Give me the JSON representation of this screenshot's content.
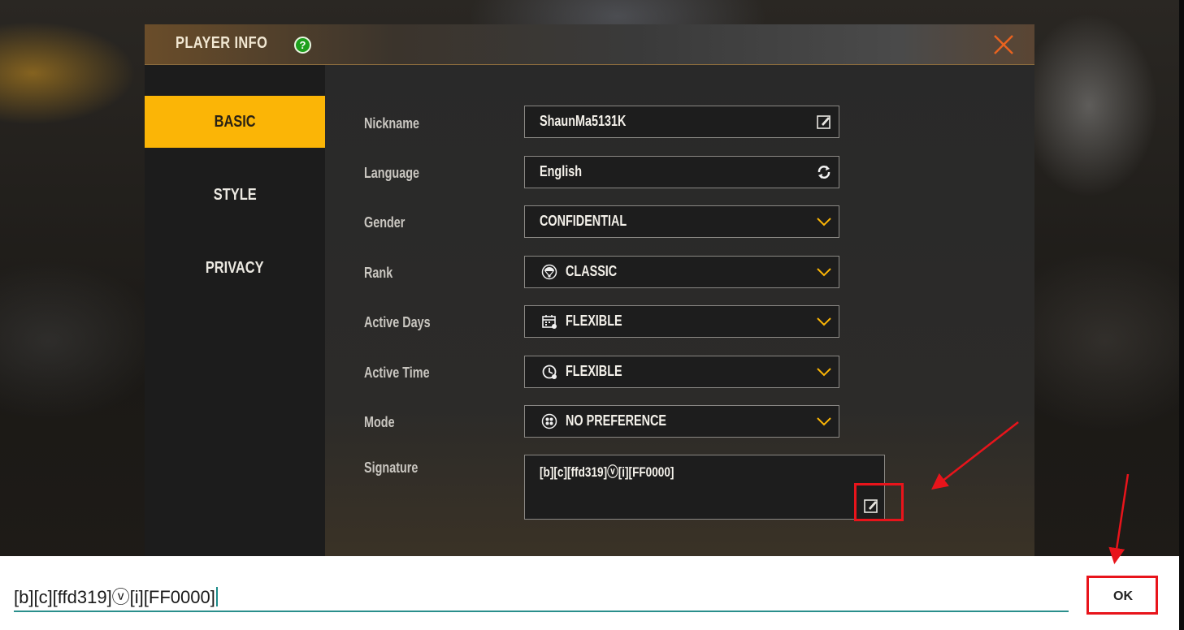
{
  "dialog": {
    "title": "PLAYER INFO",
    "help_label": "?",
    "colors": {
      "accent": "#fbb506",
      "close": "#e8621f",
      "highlight": "#e8141b"
    }
  },
  "sidebar": {
    "items": [
      {
        "label": "BASIC",
        "active": true
      },
      {
        "label": "STYLE",
        "active": false
      },
      {
        "label": "PRIVACY",
        "active": false
      }
    ]
  },
  "fields": {
    "nickname": {
      "label": "Nickname",
      "value": "ShaunMa5131K",
      "icon": "edit-icon"
    },
    "language": {
      "label": "Language",
      "value": "English",
      "icon": "refresh-icon"
    },
    "gender": {
      "label": "Gender",
      "value": "CONFIDENTIAL",
      "icon": "chevron-down-icon"
    },
    "rank": {
      "label": "Rank",
      "value": "CLASSIC",
      "icon": "parachute-icon"
    },
    "active_days": {
      "label": "Active Days",
      "value": "FLEXIBLE",
      "icon": "calendar-icon"
    },
    "active_time": {
      "label": "Active Time",
      "value": "FLEXIBLE",
      "icon": "clock-icon"
    },
    "mode": {
      "label": "Mode",
      "value": "NO PREFERENCE",
      "icon": "team-icon"
    },
    "signature": {
      "label": "Signature",
      "value": "[b][c][ffd319]ⓥ[i][FF0000]",
      "icon": "edit-icon"
    }
  },
  "input_bar": {
    "value": "[b][c][ffd319]ⓥ[i][FF0000]",
    "ok_label": "OK"
  }
}
